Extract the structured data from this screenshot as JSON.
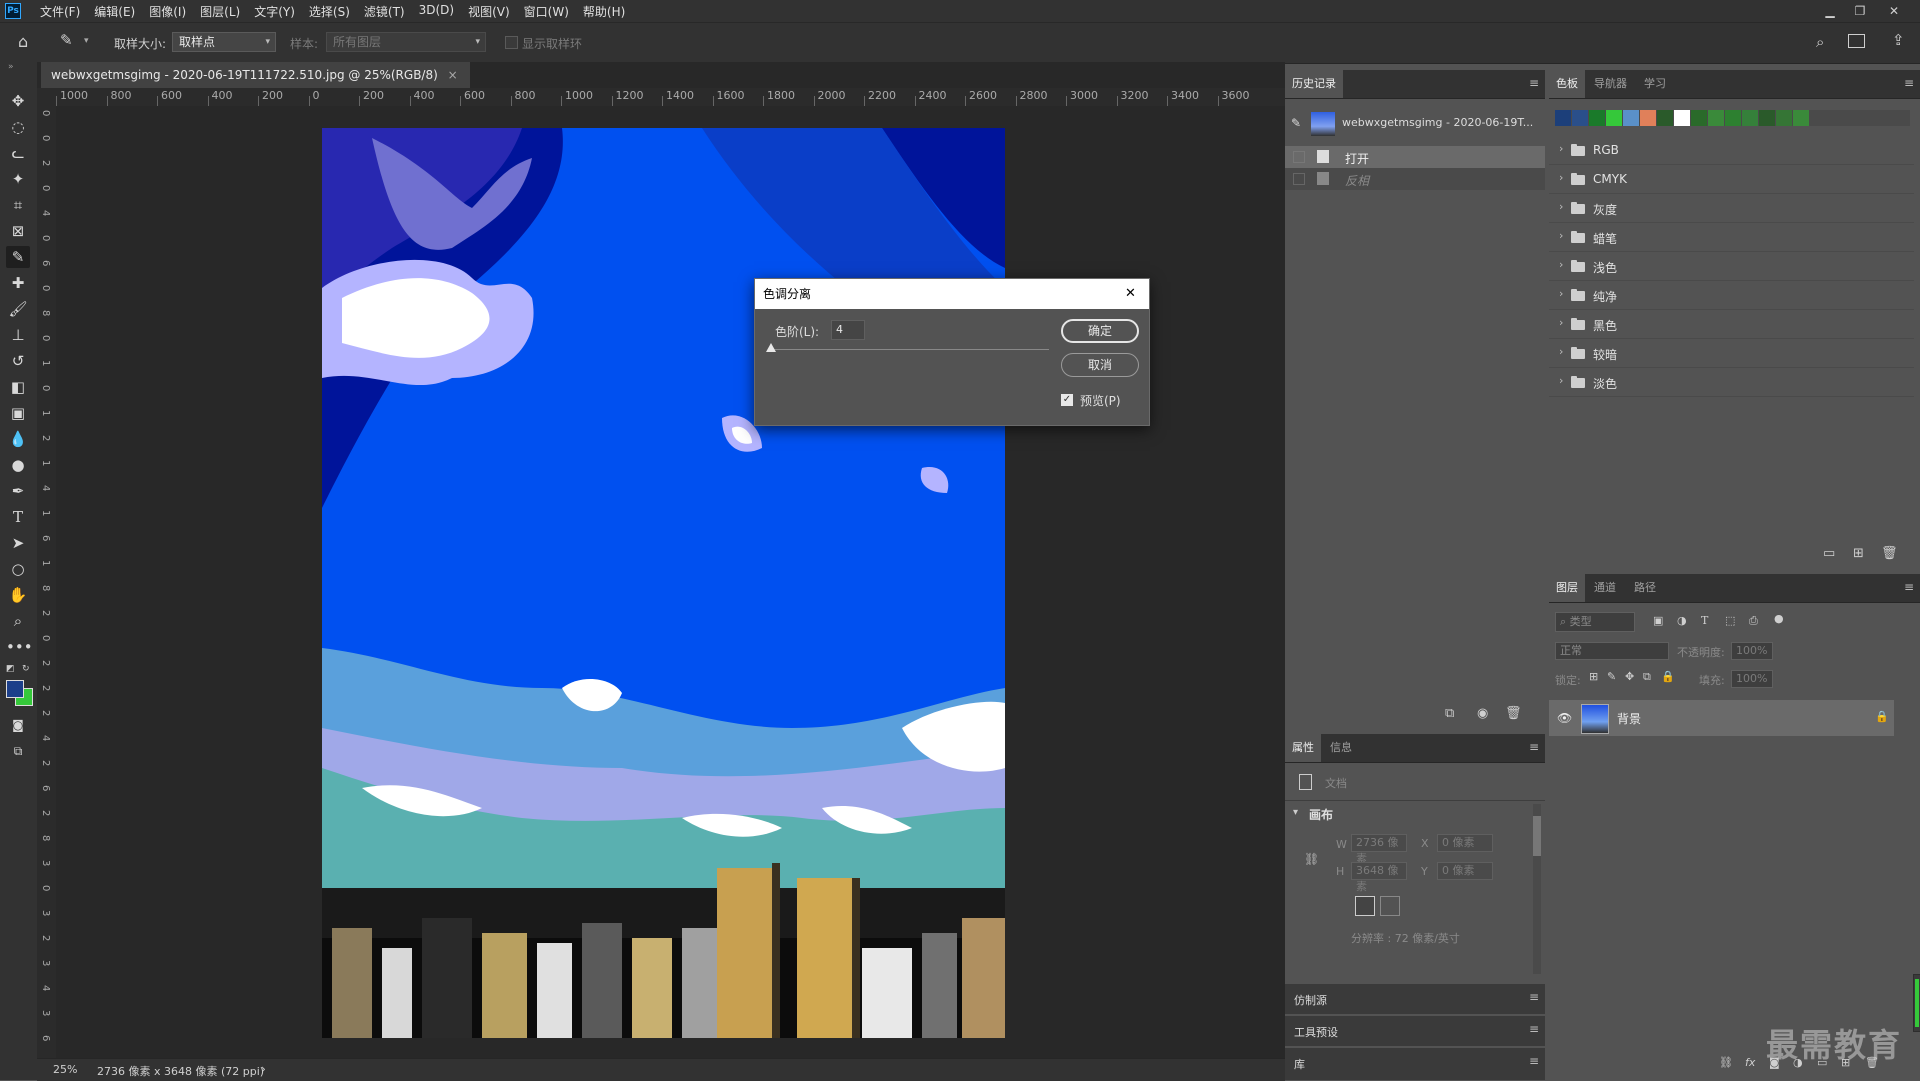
{
  "menu": [
    "文件(F)",
    "编辑(E)",
    "图像(I)",
    "图层(L)",
    "文字(Y)",
    "选择(S)",
    "滤镜(T)",
    "3D(D)",
    "视图(V)",
    "窗口(W)",
    "帮助(H)"
  ],
  "app_logo": "Ps",
  "options": {
    "sample_size_label": "取样大小:",
    "sample_size_value": "取样点",
    "sample_label": "样本:",
    "sample_value": "所有图层",
    "show_ring": "显示取样环"
  },
  "doc": {
    "tab_title": "webwxgetmsgimg - 2020-06-19T111722.510.jpg @ 25%(RGB/8)",
    "close": "×"
  },
  "ruler_h": [
    "1000",
    "800",
    "600",
    "400",
    "200",
    "0",
    "200",
    "400",
    "600",
    "800",
    "1000",
    "1200",
    "1400",
    "1600",
    "1800",
    "2000",
    "2200",
    "2400",
    "2600",
    "2800",
    "3000",
    "3200",
    "3400",
    "3600"
  ],
  "ruler_v": [
    "0",
    "0",
    "2",
    "0",
    "4",
    "0",
    "6",
    "0",
    "8",
    "0",
    "1",
    "0",
    "1",
    "2",
    "1",
    "4",
    "1",
    "6",
    "1",
    "8",
    "2",
    "0",
    "2",
    "2",
    "2",
    "4",
    "2",
    "6",
    "2",
    "8",
    "3",
    "0",
    "3",
    "2",
    "3",
    "4",
    "3",
    "6"
  ],
  "status": {
    "zoom": "25%",
    "info": "2736 像素 x 3648 像素 (72 ppi)",
    "arrow": "›"
  },
  "dialog": {
    "title": "色调分离",
    "levels_label": "色阶(L):",
    "levels_value": "4",
    "levels_fraction": 0.0,
    "ok": "确定",
    "cancel": "取消",
    "preview": "预览(P)",
    "close": "✕"
  },
  "history": {
    "tab": "历史记录",
    "snapshot": "webwxgetmsgimg - 2020-06-19T...",
    "items": [
      "打开",
      "反相"
    ]
  },
  "properties": {
    "tabs": [
      "属性",
      "信息"
    ],
    "doc_label": "文档",
    "canvas_label": "画布",
    "w_label": "W",
    "w_value": "2736 像素",
    "h_label": "H",
    "h_value": "3648 像素",
    "x_label": "X",
    "x_value": "0 像素",
    "y_label": "Y",
    "y_value": "0 像素",
    "resolution": "分辨率 : 72 像素/英寸"
  },
  "collapsed_panels": [
    "仿制源",
    "工具预设",
    "库"
  ],
  "swatches": {
    "tabs": [
      "色板",
      "导航器",
      "学习"
    ],
    "colors": [
      "#1c3f7a",
      "#2a4f8a",
      "#1a7a2a",
      "#35c83a",
      "#5a90c8",
      "#e0805a",
      "#2a5a2a",
      "#ffffff",
      "#2a6a2a",
      "#3a8a3a",
      "#2d8030",
      "#35803a",
      "#2a5a2a",
      "#357535",
      "#3a8a3a"
    ],
    "groups": [
      "RGB",
      "CMYK",
      "灰度",
      "蜡笔",
      "浅色",
      "纯净",
      "黑色",
      "较暗",
      "淡色"
    ]
  },
  "layers": {
    "tabs": [
      "图层",
      "通道",
      "路径"
    ],
    "filter": "类型",
    "blend": "正常",
    "opacity_label": "不透明度:",
    "opacity_value": "100%",
    "lock_label": "锁定:",
    "fill_label": "填充:",
    "fill_value": "100%",
    "items": [
      {
        "name": "背景"
      }
    ]
  },
  "watermark": "最需教育"
}
